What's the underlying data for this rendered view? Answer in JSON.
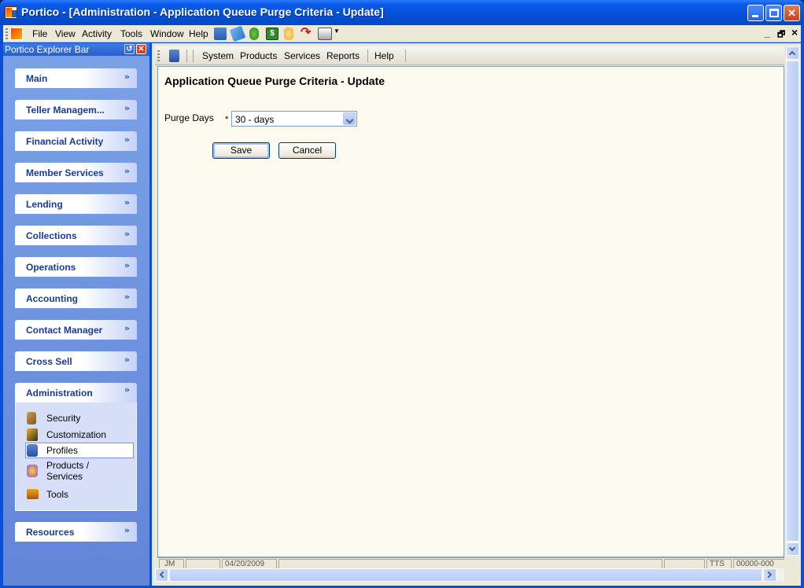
{
  "window": {
    "title": "Portico - [Administration - Application Queue Purge Criteria - Update]",
    "accent": "#0550d8"
  },
  "menubar": {
    "items": [
      "File",
      "View",
      "Activity",
      "Tools",
      "Window",
      "Help"
    ],
    "toolbar_icons": [
      "network-icon",
      "tag-icon",
      "money-bag-icon",
      "cash-icon",
      "hand-icon",
      "redo-arrow-icon",
      "printer-icon"
    ],
    "mdi_minimize": "_",
    "mdi_restore": "🗗",
    "mdi_close": "×"
  },
  "explorer": {
    "title": "Portico Explorer Bar",
    "groups": [
      {
        "label": "Main"
      },
      {
        "label": "Teller Managem..."
      },
      {
        "label": "Financial Activity"
      },
      {
        "label": "Member Services"
      },
      {
        "label": "Lending"
      },
      {
        "label": "Collections"
      },
      {
        "label": "Operations"
      },
      {
        "label": "Accounting"
      },
      {
        "label": "Contact Manager"
      },
      {
        "label": "Cross Sell"
      },
      {
        "label": "Administration"
      },
      {
        "label": "Resources"
      }
    ],
    "admin_tasks": [
      {
        "label": "Security",
        "icon": "keys-icon"
      },
      {
        "label": "Customization",
        "icon": "paint-tools-icon"
      },
      {
        "label": "Profiles",
        "icon": "profile-icon",
        "selected": true
      },
      {
        "label": "Products /",
        "label2": "Services",
        "icon": "products-icon"
      },
      {
        "label": "Tools",
        "icon": "toolbox-icon"
      }
    ]
  },
  "page_toolbar": {
    "items": [
      "System",
      "Products",
      "Services",
      "Reports",
      "Help"
    ]
  },
  "form": {
    "title": "Application Queue Purge Criteria - Update",
    "purge_days_label": "Purge Days",
    "required_marker": "*",
    "purge_days_value": "30 - days",
    "save_label": "Save",
    "cancel_label": "Cancel"
  },
  "status": {
    "cells": [
      "JM",
      "",
      "04/20/2009",
      "",
      "",
      "TTS",
      "00000-000"
    ]
  }
}
